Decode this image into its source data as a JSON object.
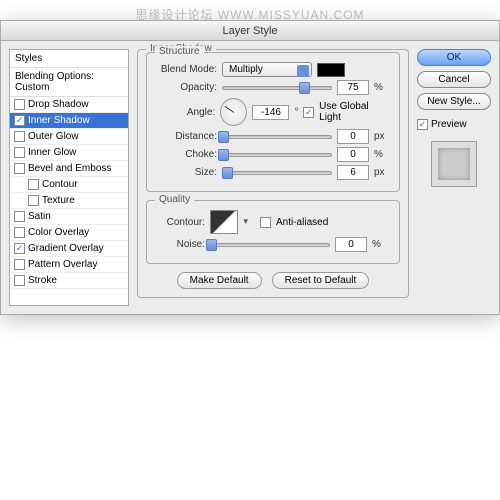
{
  "watermark": "思缘设计论坛   WWW.MISSYUAN.COM",
  "dialog": {
    "title": "Layer Style"
  },
  "sidebar": {
    "header1": "Styles",
    "header2": "Blending Options: Custom",
    "items": [
      {
        "label": "Drop Shadow",
        "checked": false,
        "selected": false,
        "indent": false
      },
      {
        "label": "Inner Shadow",
        "checked": true,
        "selected": true,
        "indent": false
      },
      {
        "label": "Outer Glow",
        "checked": false,
        "selected": false,
        "indent": false
      },
      {
        "label": "Inner Glow",
        "checked": false,
        "selected": false,
        "indent": false
      },
      {
        "label": "Bevel and Emboss",
        "checked": false,
        "selected": false,
        "indent": false
      },
      {
        "label": "Contour",
        "checked": false,
        "selected": false,
        "indent": true
      },
      {
        "label": "Texture",
        "checked": false,
        "selected": false,
        "indent": true
      },
      {
        "label": "Satin",
        "checked": false,
        "selected": false,
        "indent": false
      },
      {
        "label": "Color Overlay",
        "checked": false,
        "selected": false,
        "indent": false
      },
      {
        "label": "Gradient Overlay",
        "checked": true,
        "selected": false,
        "indent": false
      },
      {
        "label": "Pattern Overlay",
        "checked": false,
        "selected": false,
        "indent": false
      },
      {
        "label": "Stroke",
        "checked": false,
        "selected": false,
        "indent": false
      }
    ]
  },
  "panel": {
    "title": "Inner Shadow",
    "structure": {
      "legend": "Structure",
      "blend_mode_label": "Blend Mode:",
      "blend_mode_value": "Multiply",
      "color": "#000000",
      "opacity_label": "Opacity:",
      "opacity_value": "75",
      "opacity_unit": "%",
      "angle_label": "Angle:",
      "angle_value": "-146",
      "angle_unit": "°",
      "global_light_label": "Use Global Light",
      "global_light_checked": true,
      "distance_label": "Distance:",
      "distance_value": "0",
      "distance_unit": "px",
      "choke_label": "Choke:",
      "choke_value": "0",
      "choke_unit": "%",
      "size_label": "Size:",
      "size_value": "6",
      "size_unit": "px"
    },
    "quality": {
      "legend": "Quality",
      "contour_label": "Contour:",
      "antialiased_label": "Anti-aliased",
      "antialiased_checked": false,
      "noise_label": "Noise:",
      "noise_value": "0",
      "noise_unit": "%"
    },
    "buttons": {
      "make_default": "Make Default",
      "reset_default": "Reset to Default"
    }
  },
  "right": {
    "ok": "OK",
    "cancel": "Cancel",
    "new_style": "New Style...",
    "preview_label": "Preview",
    "preview_checked": true
  }
}
